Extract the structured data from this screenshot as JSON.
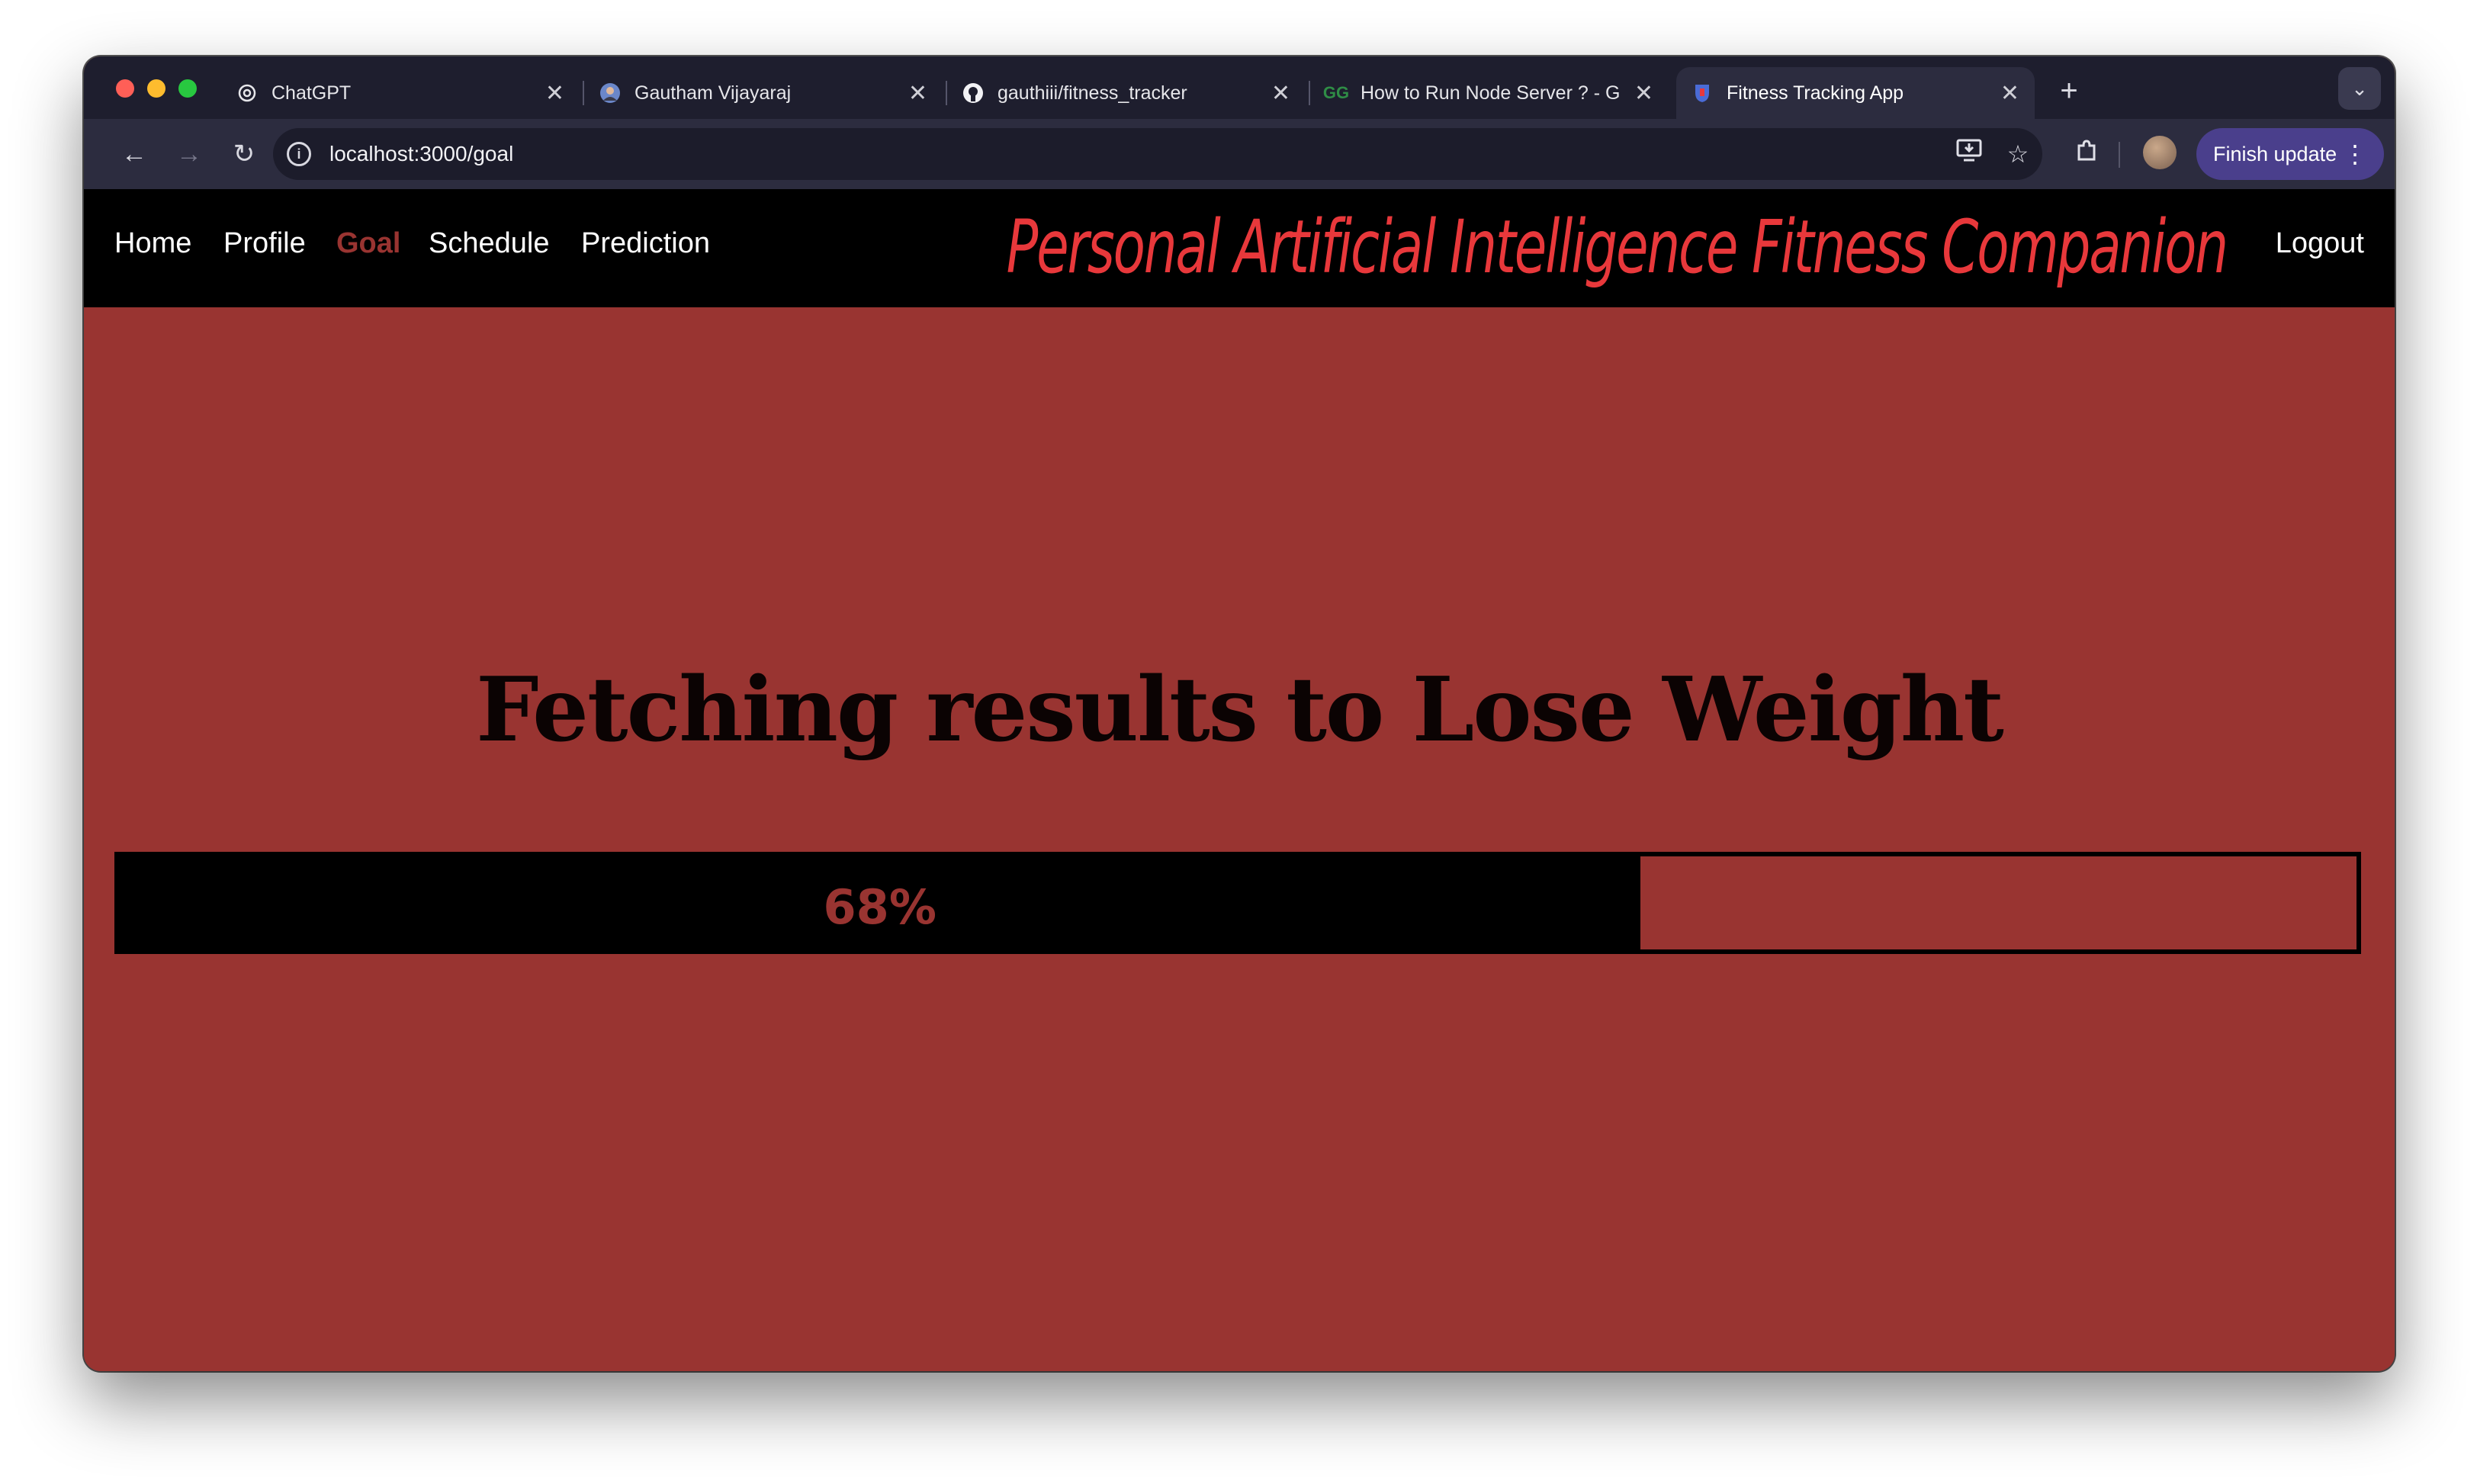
{
  "browser": {
    "tabs": [
      {
        "title": "ChatGPT",
        "icon": "chatgpt-icon"
      },
      {
        "title": "Gautham Vijayaraj",
        "icon": "profile-avatar-icon"
      },
      {
        "title": "gauthiii/fitness_tracker",
        "icon": "github-icon"
      },
      {
        "title": "How to Run Node Server ? - G",
        "icon": "geeksforgeeks-icon"
      },
      {
        "title": "Fitness Tracking App",
        "icon": "app-favicon-icon",
        "active": true
      }
    ],
    "url": "localhost:3000/goal",
    "finish_update_label": "Finish update"
  },
  "nav": {
    "links": [
      "Home",
      "Profile",
      "Goal",
      "Schedule",
      "Prediction"
    ],
    "active": "Goal",
    "brand": "Personal Artificial Intelligence Fitness Companion",
    "logout": "Logout"
  },
  "main": {
    "heading": "Fetching results to Lose Weight",
    "progress_percent": 68,
    "progress_label": "68%"
  },
  "colors": {
    "accent": "#993431",
    "brand": "#e8383b",
    "nav_bg": "#000000"
  }
}
